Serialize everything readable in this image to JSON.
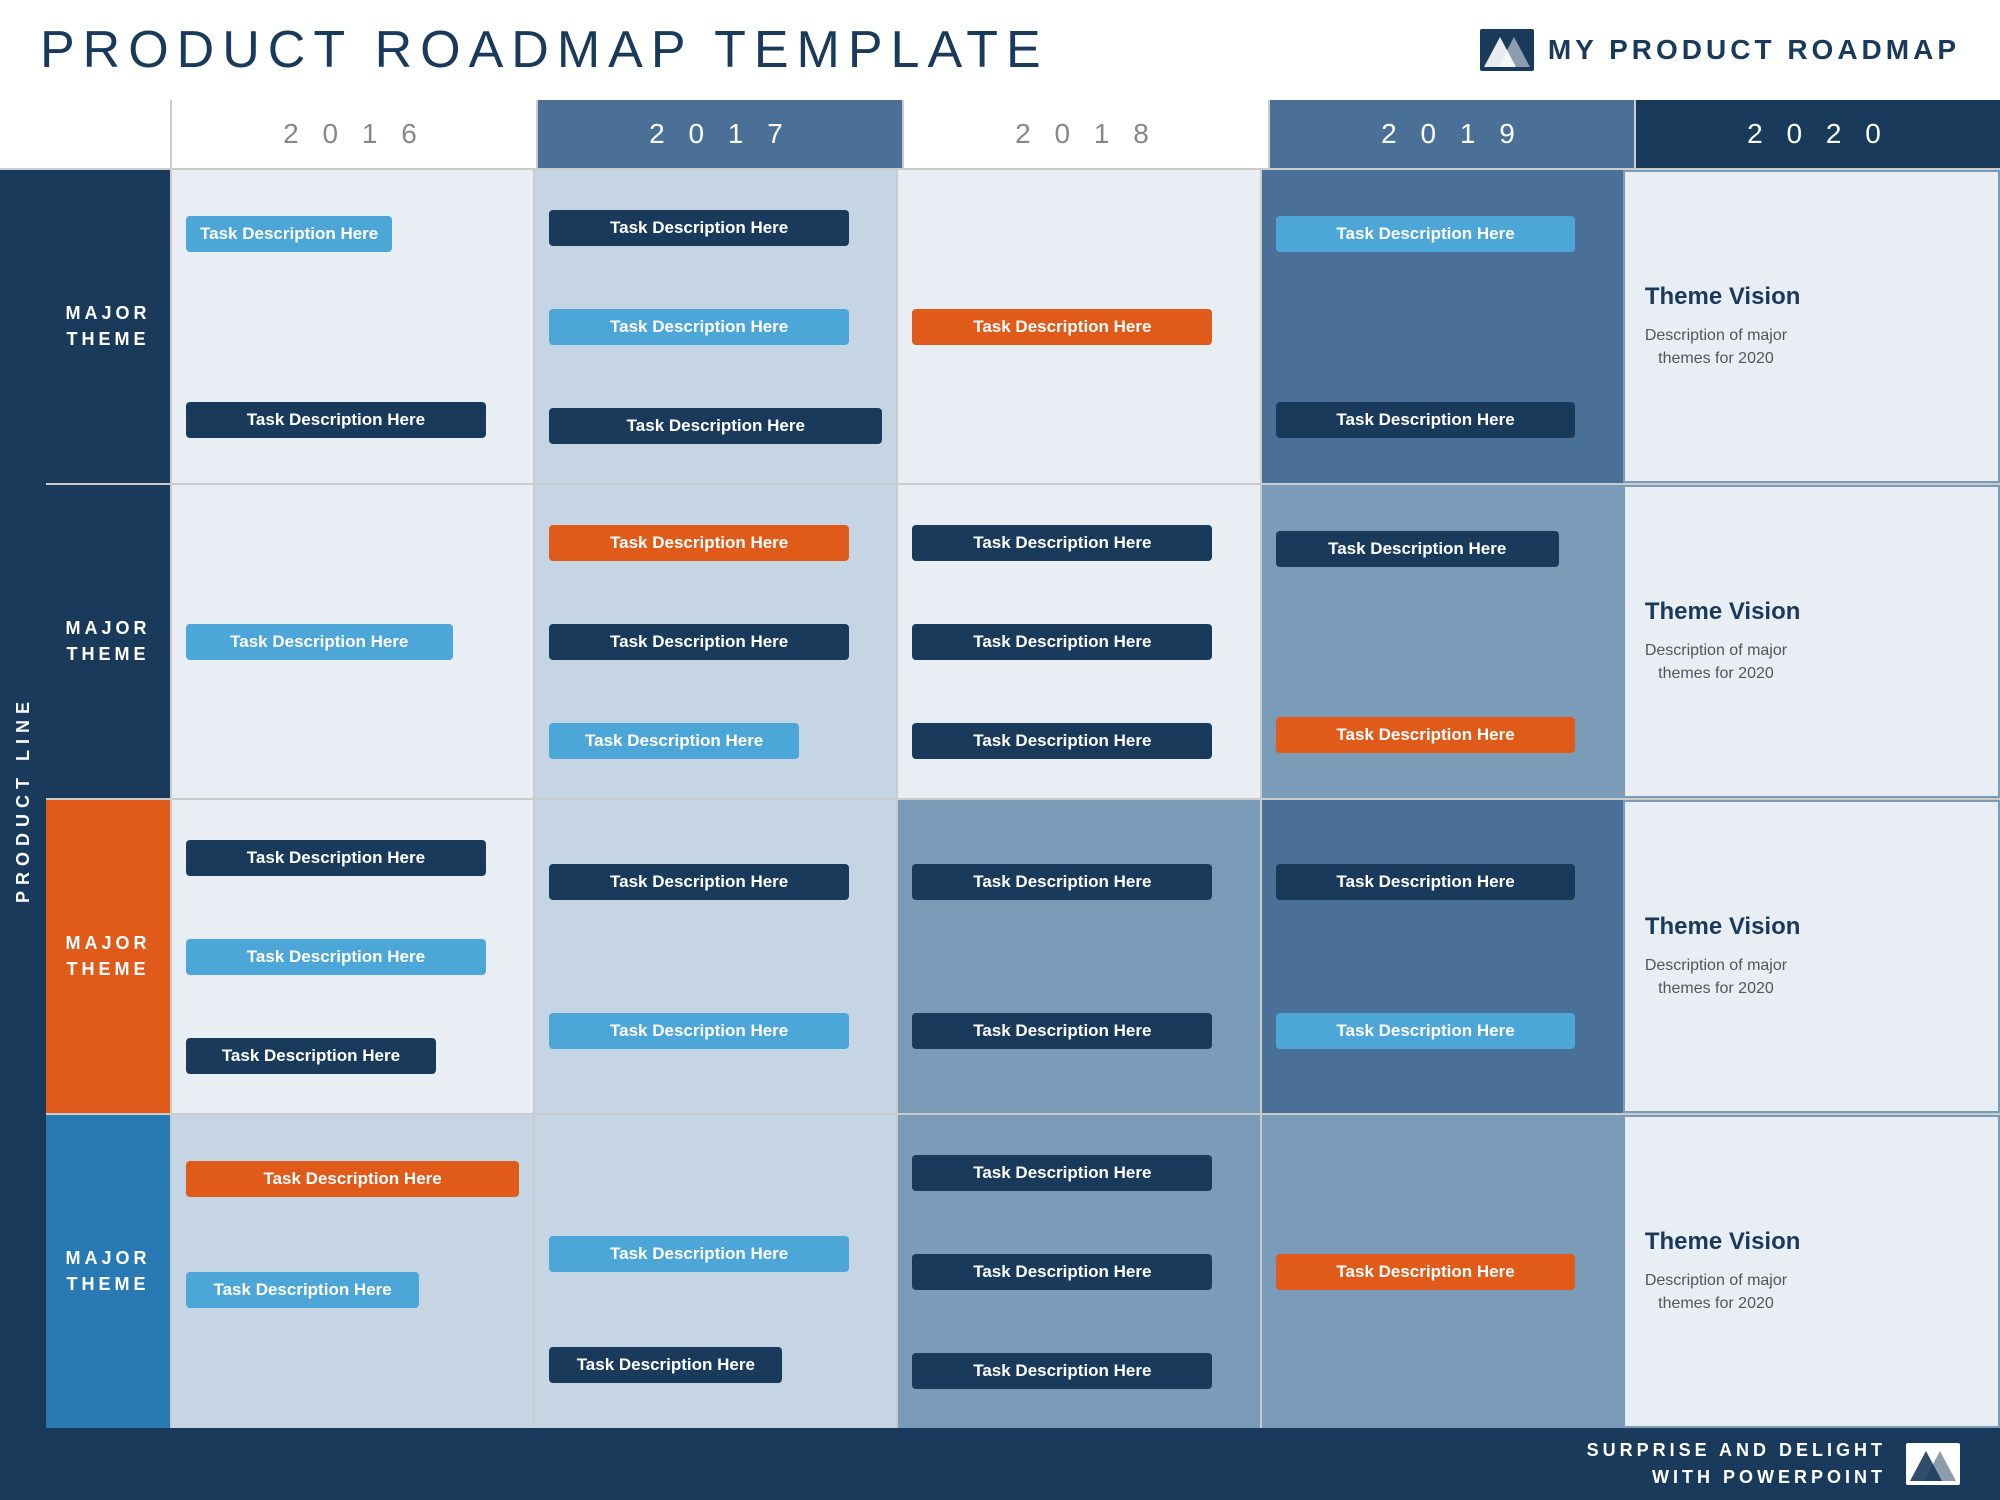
{
  "header": {
    "title": "PRODUCT ROADMAP TEMPLATE",
    "logo_text": "MY PRODUCT ROADMAP"
  },
  "years": [
    "2016",
    "2017",
    "2018",
    "2019",
    "2020"
  ],
  "product_line_label": "PRODUCT LINE",
  "rows": [
    {
      "theme_label": "MAJOR\nTHEME",
      "theme_color": "navy",
      "cells": [
        {
          "year": "2016",
          "bg": "light",
          "tasks": [
            {
              "label": "Task Description Here",
              "color": "light-blue",
              "width": "partial"
            },
            {
              "label": "Task Description Here",
              "color": "navy",
              "width": "full"
            }
          ]
        },
        {
          "year": "2017",
          "bg": "medium",
          "tasks": [
            {
              "label": "Task Description Here",
              "color": "navy",
              "width": "full"
            },
            {
              "label": "Task Description Here",
              "color": "light-blue",
              "width": "full"
            },
            {
              "label": "Task Description Here",
              "color": "navy",
              "width": "full"
            }
          ]
        },
        {
          "year": "2018",
          "bg": "light",
          "tasks": [
            {
              "label": "Task Description Here",
              "color": "orange",
              "width": "full"
            }
          ]
        },
        {
          "year": "2019",
          "bg": "darker",
          "tasks": [
            {
              "label": "Task Description Here",
              "color": "light-blue",
              "width": "full"
            },
            {
              "label": "Task Description Here",
              "color": "navy",
              "width": "full"
            }
          ]
        },
        {
          "year": "2020",
          "bg": "vision",
          "vision_title": "Theme Vision",
          "vision_desc": "Description of major themes for 2020"
        }
      ]
    },
    {
      "theme_label": "MAJOR\nTHEME",
      "theme_color": "navy",
      "cells": [
        {
          "year": "2016",
          "bg": "light",
          "tasks": [
            {
              "label": "Task Description Here",
              "color": "light-blue",
              "width": "partial"
            }
          ]
        },
        {
          "year": "2017",
          "bg": "medium",
          "tasks": [
            {
              "label": "Task Description Here",
              "color": "orange",
              "width": "full"
            },
            {
              "label": "Task Description Here",
              "color": "navy",
              "width": "full"
            },
            {
              "label": "Task Description Here",
              "color": "light-blue",
              "width": "full"
            }
          ]
        },
        {
          "year": "2018",
          "bg": "light",
          "tasks": [
            {
              "label": "Task Description Here",
              "color": "navy",
              "width": "full"
            },
            {
              "label": "Task Description Here",
              "color": "navy",
              "width": "full"
            },
            {
              "label": "Task Description Here",
              "color": "navy",
              "width": "full"
            }
          ]
        },
        {
          "year": "2019",
          "bg": "dark",
          "tasks": [
            {
              "label": "Task Description Here",
              "color": "navy",
              "width": "full"
            },
            {
              "label": "Task Description Here",
              "color": "orange",
              "width": "full"
            }
          ]
        },
        {
          "year": "2020",
          "bg": "vision",
          "vision_title": "Theme Vision",
          "vision_desc": "Description of major themes for 2020"
        }
      ]
    },
    {
      "theme_label": "MAJOR\nTHEME",
      "theme_color": "orange",
      "cells": [
        {
          "year": "2016",
          "bg": "light",
          "tasks": [
            {
              "label": "Task Description Here",
              "color": "navy",
              "width": "full"
            },
            {
              "label": "Task Description Here",
              "color": "light-blue",
              "width": "full"
            },
            {
              "label": "Task Description Here",
              "color": "navy",
              "width": "partial"
            }
          ]
        },
        {
          "year": "2017",
          "bg": "medium",
          "tasks": [
            {
              "label": "Task Description Here",
              "color": "navy",
              "width": "full"
            },
            {
              "label": "Task Description Here",
              "color": "light-blue",
              "width": "full"
            }
          ]
        },
        {
          "year": "2018",
          "bg": "dark",
          "tasks": [
            {
              "label": "Task Description Here",
              "color": "navy",
              "width": "full"
            },
            {
              "label": "Task Description Here",
              "color": "navy",
              "width": "full"
            }
          ]
        },
        {
          "year": "2019",
          "bg": "darker",
          "tasks": [
            {
              "label": "Task Description Here",
              "color": "navy",
              "width": "full"
            },
            {
              "label": "Task Description Here",
              "color": "light-blue",
              "width": "full"
            }
          ]
        },
        {
          "year": "2020",
          "bg": "vision",
          "vision_title": "Theme Vision",
          "vision_desc": "Description of major themes for 2020"
        }
      ]
    },
    {
      "theme_label": "MAJOR\nTHEME",
      "theme_color": "blue",
      "cells": [
        {
          "year": "2016",
          "bg": "medium",
          "tasks": [
            {
              "label": "Task Description Here",
              "color": "orange",
              "width": "span"
            },
            {
              "label": "Task Description Here",
              "color": "light-blue",
              "width": "partial"
            }
          ]
        },
        {
          "year": "2017",
          "bg": "medium",
          "tasks": [
            {
              "label": "Task Description Here",
              "color": "light-blue",
              "width": "full"
            },
            {
              "label": "Task Description Here",
              "color": "navy",
              "width": "partial"
            }
          ]
        },
        {
          "year": "2018",
          "bg": "dark",
          "tasks": [
            {
              "label": "Task Description Here",
              "color": "navy",
              "width": "full"
            },
            {
              "label": "Task Description Here",
              "color": "navy",
              "width": "full"
            },
            {
              "label": "Task Description Here",
              "color": "navy",
              "width": "full"
            }
          ]
        },
        {
          "year": "2019",
          "bg": "dark",
          "tasks": [
            {
              "label": "Task Description Here",
              "color": "orange",
              "width": "full"
            }
          ]
        },
        {
          "year": "2020",
          "bg": "vision",
          "vision_title": "Theme Vision",
          "vision_desc": "Description of major themes for 2020"
        }
      ]
    }
  ],
  "footer": {
    "line1": "SURPRISE AND DELIGHT",
    "line2": "WITH POWERPOINT"
  }
}
